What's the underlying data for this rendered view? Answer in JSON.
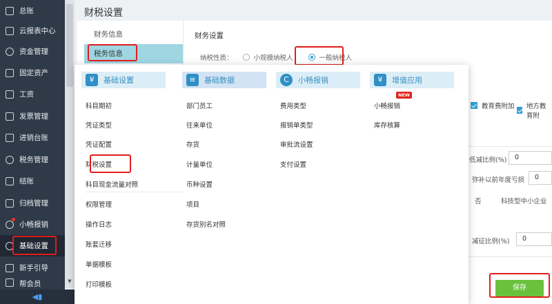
{
  "sidebar": {
    "items": [
      {
        "label": "总账",
        "icon": "ledger-icon"
      },
      {
        "label": "云报表中心",
        "icon": "report-chart-icon"
      },
      {
        "label": "资金管理",
        "icon": "money-icon"
      },
      {
        "label": "固定资产",
        "icon": "asset-icon"
      },
      {
        "label": "工资",
        "icon": "salary-icon"
      },
      {
        "label": "发票管理",
        "icon": "invoice-icon"
      },
      {
        "label": "进销台账",
        "icon": "inventory-icon"
      },
      {
        "label": "税务管理",
        "icon": "tax-icon"
      },
      {
        "label": "结账",
        "icon": "close-books-icon"
      },
      {
        "label": "归档管理",
        "icon": "archive-icon"
      },
      {
        "label": "小畅报销",
        "icon": "reimburse-icon"
      },
      {
        "label": "基础设置",
        "icon": "settings-gear-icon"
      },
      {
        "label": "新手引导",
        "icon": "guide-icon"
      },
      {
        "label": "帮会员",
        "icon": "member-icon"
      }
    ],
    "collapse_icon": "◀▮"
  },
  "page": {
    "title": "财税设置"
  },
  "subnav": {
    "items": [
      "财务信息",
      "税务信息"
    ]
  },
  "tax_settings": {
    "section_title": "财务设置",
    "taxpayer_label": "纳税性质：",
    "options": [
      "小规模纳税人",
      "一般纳税人"
    ],
    "selected": "一般纳税人"
  },
  "form": {
    "checks": [
      "教育费附加",
      "地方教育附"
    ],
    "reduce_ratio_label": "低减比例(%)",
    "reduce_ratio_value": "0",
    "loss_label": "弥补以前年度亏损",
    "loss_value": "0",
    "no_label": "否",
    "tech_sme_label": "科技型中小企业",
    "deduct_ratio_label": "减征比例(%)",
    "deduct_ratio_value": "0",
    "save_label": "保存"
  },
  "menu": {
    "columns": [
      {
        "title": "基础设置",
        "icon": "basic-settings-icon",
        "items": [
          "科目期初",
          "凭证类型",
          "凭证配置",
          "财税设置",
          "科目现金流量对照",
          "权限管理",
          "操作日志",
          "账套迁移",
          "单据模板",
          "打印模板"
        ]
      },
      {
        "title": "基础数据",
        "icon": "basic-data-icon",
        "items": [
          "部门员工",
          "往来单位",
          "存货",
          "计量单位",
          "币种设置",
          "项目",
          "存货别名对照"
        ]
      },
      {
        "title": "小畅报销",
        "icon": "reimburse-brand-icon",
        "items": [
          "费用类型",
          "报销单类型",
          "审批流设置",
          "支付设置"
        ]
      },
      {
        "title": "增值应用",
        "icon": "value-added-icon",
        "items": [
          "小畅报销",
          "库存核算"
        ]
      }
    ],
    "new_badge": "NEW"
  },
  "colors": {
    "sidebar_bg": "#2f3a48",
    "accent": "#2f9fd6",
    "highlight_box": "#e21d1d",
    "save_button": "#6ac23c"
  }
}
